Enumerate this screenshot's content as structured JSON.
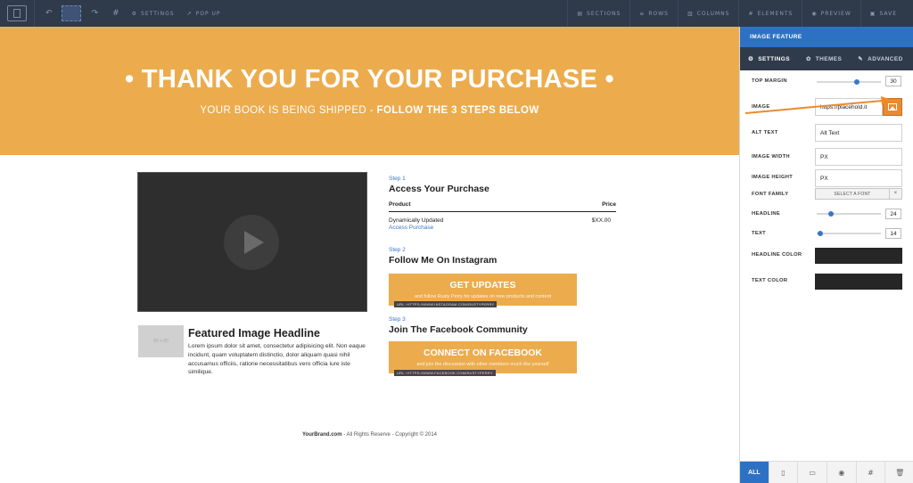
{
  "toolbar": {
    "settings_label": "SETTINGS",
    "popup_label": "POP UP",
    "sections_label": "SECTIONS",
    "rows_label": "ROWS",
    "columns_label": "COLUMNS",
    "elements_label": "ELEMENTS",
    "preview_label": "PREVIEW",
    "save_label": "SAVE"
  },
  "hero": {
    "title": "• THANK YOU FOR YOUR PURCHASE •",
    "subtitle_plain": "YOUR BOOK IS BEING SHIPPED - ",
    "subtitle_bold": "FOLLOW THE 3 STEPS BELOW"
  },
  "feature": {
    "thumb_text": "80 x 80",
    "headline": "Featured Image Headline",
    "text": "Lorem ipsum dolor sit amet, consectetur adipisicing elit. Non eaque incidunt, quam voluptatem distinctio, dolor aliquam quasi nihil accusamus officiis, ratione necessitatibus vero officia iure iste similique."
  },
  "steps": {
    "step1": {
      "label": "Step 1",
      "title": "Access Your Purchase",
      "col_product": "Product",
      "col_price": "Price",
      "row_product": "Dynamically Updated",
      "row_link": "Access Purchase",
      "row_price": "$XX.00"
    },
    "step2": {
      "label": "Step 2",
      "title": "Follow Me On Instagram",
      "button": "GET UPDATES",
      "button_sub": "and follow Rusty Perry for updates on new products and content",
      "url": "URL: HTTPS://WWW.INSTAGRAM.COM/RUSTYPERRY"
    },
    "step3": {
      "label": "Step 3",
      "title": "Join The Facebook Community",
      "button": "CONNECT ON FACEBOOK",
      "button_sub": "and join the discussion with other members much like yourself",
      "url": "URL: HTTPS://WWW.FACEBOOK.COM/RUSTYPERRY"
    }
  },
  "footer": {
    "brand": "YourBrand.com",
    "rest": " - All Rights Reserve - Copyright © 2014"
  },
  "panel": {
    "title": "IMAGE FEATURE",
    "tabs": [
      "SETTINGS",
      "THEMES",
      "ADVANCED"
    ],
    "top_margin_label": "TOP MARGIN",
    "top_margin_value": "30",
    "top_margin_level": 0.62,
    "image_label": "IMAGE",
    "image_value": "https://placehold.it",
    "alt_label": "ALT TEXT",
    "alt_value": "Alt Text",
    "width_label": "IMAGE WIDTH",
    "width_value": "PX",
    "height_label": "IMAGE HEIGHT",
    "height_value": "PX",
    "font_label": "FONT FAMILY",
    "font_button": "SELECT A FONT",
    "font_clear": "×",
    "headline_label": "HEADLINE",
    "headline_value": "24",
    "headline_level": 0.22,
    "text_label": "TEXT",
    "text_value": "14",
    "text_level": 0.05,
    "headline_color_label": "HEADLINE COLOR",
    "text_color_label": "TEXT COLOR",
    "headline_color": "#262626",
    "text_color": "#262626",
    "bottom_all": "ALL"
  },
  "colors": {
    "accent_orange": "#ecac4d",
    "panel_blue": "#2d72c2",
    "toolbar_dark": "#2f3a4b",
    "arrow_orange": "#e98b2f"
  }
}
